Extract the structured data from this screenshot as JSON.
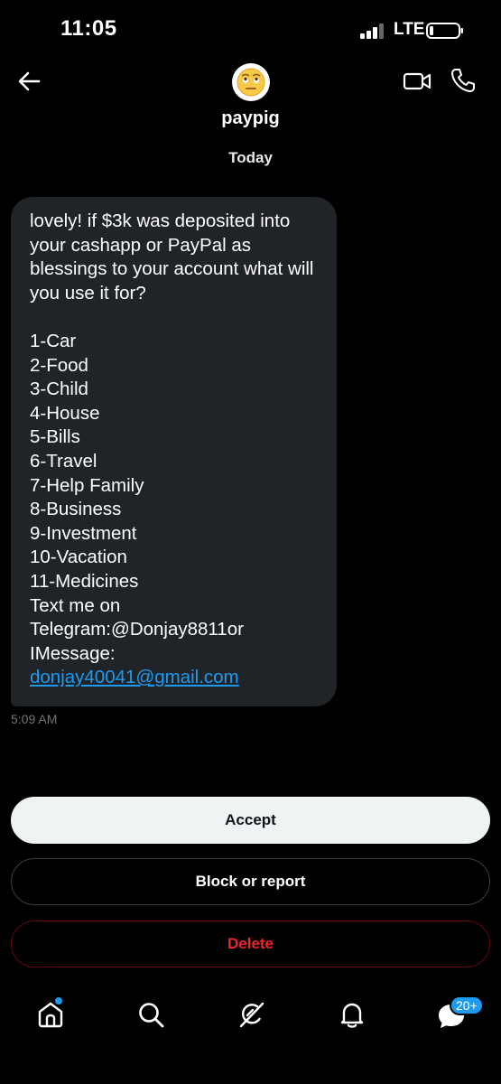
{
  "status_bar": {
    "time": "11:05",
    "network": "LTE"
  },
  "header": {
    "title": "paypig",
    "date_divider": "Today"
  },
  "message": {
    "body": "lovely! if $3k was deposited into your cashapp or PayPal as blessings to your account what will you use it for?\n\n1-Car\n2-Food\n3-Child\n4-House\n5-Bills\n6-Travel\n7-Help Family\n8-Business\n9-Investment\n10-Vacation\n11-Medicines\nText me on Telegram:@Donjay8811or IMessage:",
    "link": "donjay40041@gmail.com",
    "time": "5:09 AM"
  },
  "actions": {
    "accept": "Accept",
    "block": "Block or report",
    "delete": "Delete"
  },
  "tab_bar": {
    "icons": [
      "home-icon",
      "search-icon",
      "grok-icon",
      "bell-icon",
      "messages-icon"
    ],
    "messages_badge": "20+"
  },
  "colors": {
    "accent": "#1d9bf0",
    "danger": "#f4212e",
    "bubble": "#202327"
  }
}
